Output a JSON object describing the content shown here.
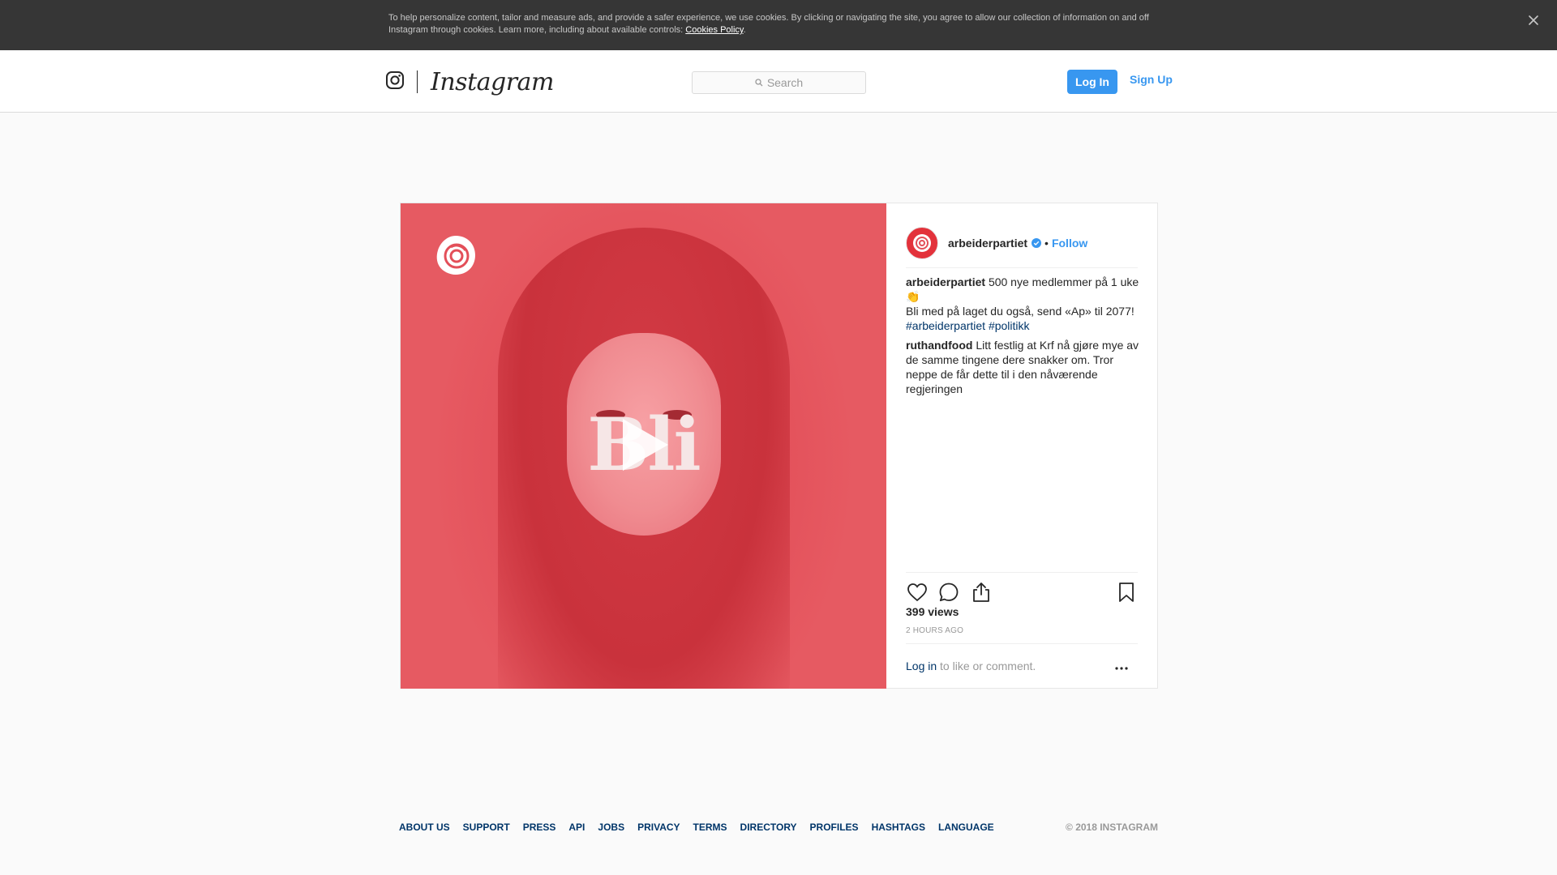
{
  "cookie_banner": {
    "text": "To help personalize content, tailor and measure ads, and provide a safer experience, we use cookies. By clicking or navigating the site, you agree to allow our collection of information on and off Instagram through cookies. Learn more, including about available controls: ",
    "link": "Cookies Policy",
    "suffix": "."
  },
  "header": {
    "brand": "Instagram",
    "search_placeholder": "Search",
    "login_label": "Log In",
    "signup_label": "Sign Up"
  },
  "post": {
    "media_overlay_text": "Bli",
    "author": "arbeiderpartiet",
    "separator": "•",
    "follow_label": "Follow",
    "caption": {
      "user": "arbeiderpartiet",
      "line1": "500 nye medlemmer på 1 uke👏",
      "line2": "Bli med på laget du også, send «Ap» til 2077!",
      "tags": [
        "#arbeiderpartiet",
        "#politikk"
      ]
    },
    "comments": [
      {
        "user": "ruthandfood",
        "text": "Litt festlig at Krf nå gjøre mye av de samme tingene dere snakker om. Tror neppe de får dette til i den nåværende regjeringen"
      }
    ],
    "views": "399 views",
    "time_ago": "2 HOURS AGO",
    "login_prompt": {
      "link": "Log in",
      "text": " to like or comment."
    }
  },
  "footer": {
    "links": [
      "ABOUT US",
      "SUPPORT",
      "PRESS",
      "API",
      "JOBS",
      "PRIVACY",
      "TERMS",
      "DIRECTORY",
      "PROFILES",
      "HASHTAGS",
      "LANGUAGE"
    ],
    "copyright": "© 2018 INSTAGRAM"
  },
  "colors": {
    "accent_blue": "#3897f0",
    "link_dark_blue": "#003569",
    "media_red": "#e34f59"
  },
  "icons": [
    "close-icon",
    "instagram-glyph-icon",
    "search-icon",
    "play-icon",
    "rose-logo-icon",
    "verified-badge-icon",
    "heart-icon",
    "comment-icon",
    "share-icon",
    "bookmark-icon",
    "more-options-icon"
  ]
}
